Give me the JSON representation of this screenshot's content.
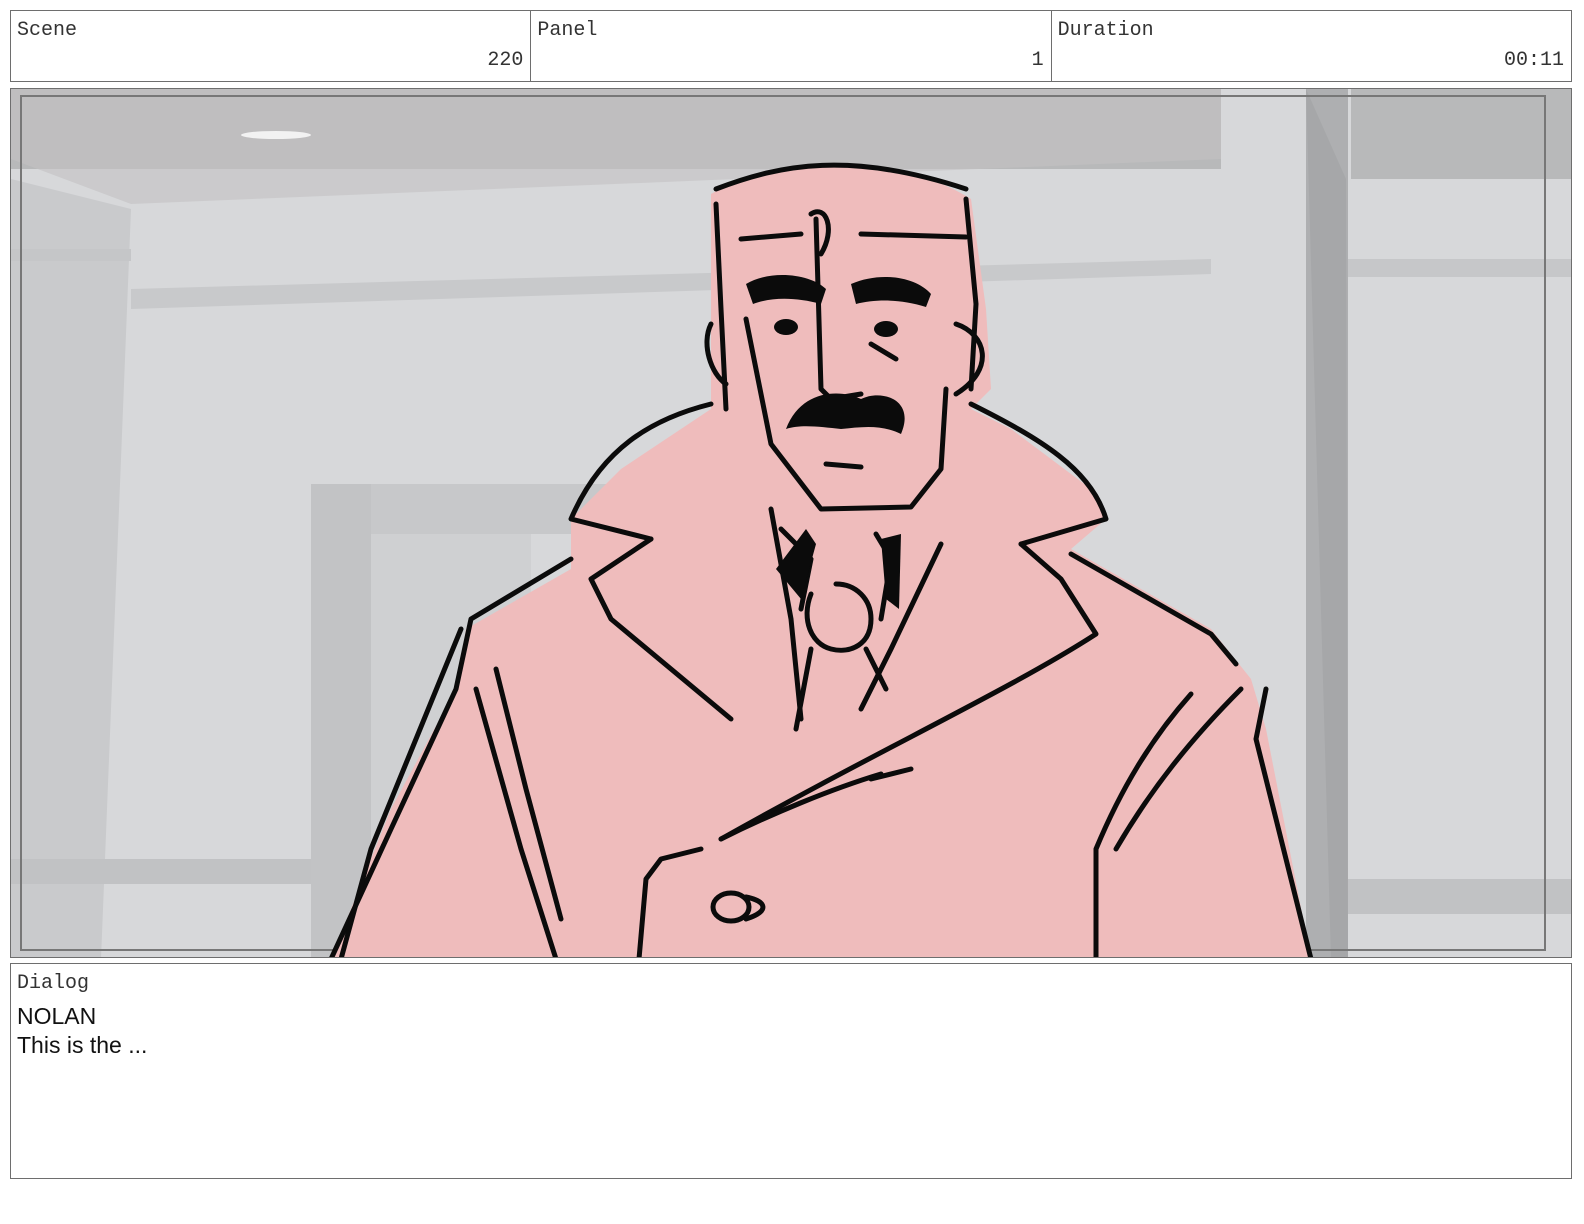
{
  "header": {
    "scene_label": "Scene",
    "scene_value": "220",
    "panel_label": "Panel",
    "panel_value": "1",
    "duration_label": "Duration",
    "duration_value": "00:11"
  },
  "panel": {
    "image_subject": "storyboard-sketch-man-in-trench-coat"
  },
  "dialog": {
    "label": "Dialog",
    "speaker": "NOLAN",
    "line": "This is the ..."
  },
  "colors": {
    "border": "#6e6e6e",
    "character_fill": "#efbcbc",
    "background_wall": "#d6d7d9",
    "ceiling": "#b7b8b9"
  }
}
